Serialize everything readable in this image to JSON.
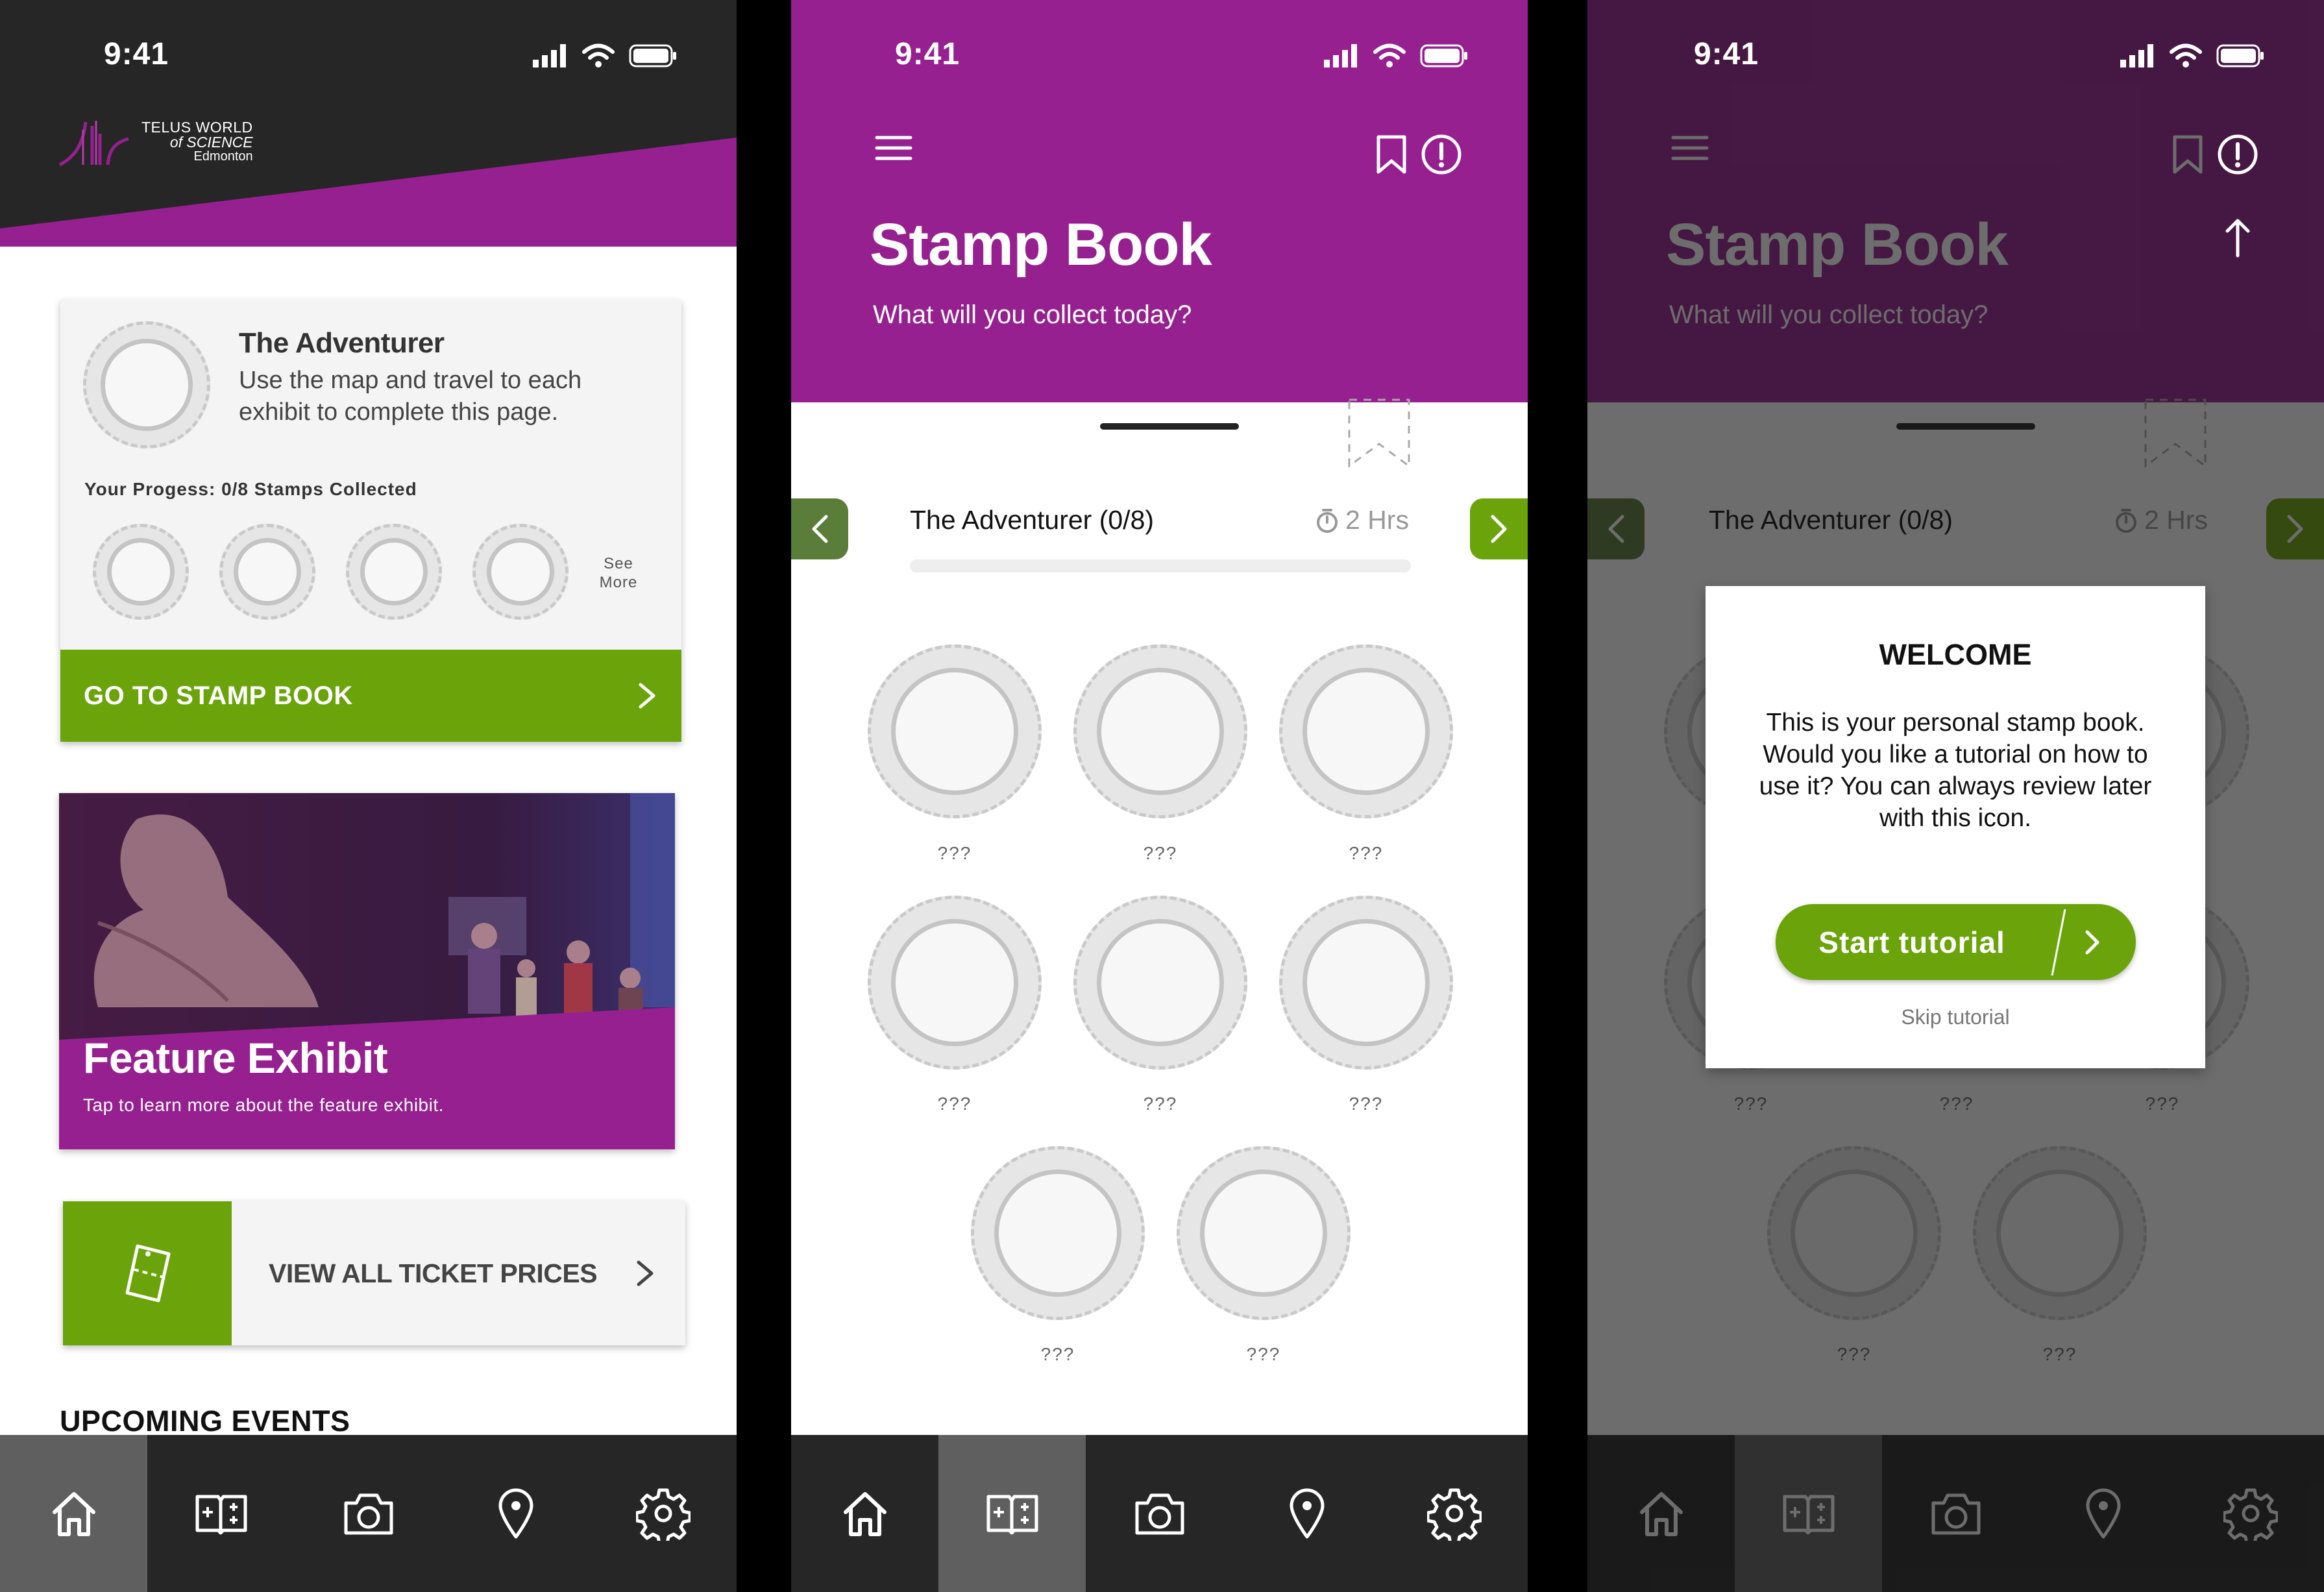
{
  "status": {
    "time": "9:41"
  },
  "screen1": {
    "logo": {
      "line1": "TELUS WORLD",
      "line2": "of SCIENCE",
      "line3": "Edmonton"
    },
    "card": {
      "title": "The Adventurer",
      "desc_line1": "Use the map and travel to each",
      "desc_line2": "exhibit to complete this page.",
      "progress": "Your Progess: 0/8 Stamps Collected",
      "see_more_1": "See",
      "see_more_2": "More",
      "cta": "GO TO STAMP BOOK"
    },
    "feature": {
      "title": "Feature Exhibit",
      "subtitle": "Tap to learn more about the feature exhibit."
    },
    "tickets": {
      "label": "VIEW ALL TICKET PRICES"
    },
    "events_heading": "UPCOMING EVENTS"
  },
  "screen2": {
    "title": "Stamp Book",
    "subtitle": "What will you collect today?",
    "page_title": "The Adventurer (0/8)",
    "duration": "2 Hrs",
    "progress": 0,
    "stamp_labels": [
      "???",
      "???",
      "???",
      "???",
      "???",
      "???",
      "???",
      "???"
    ]
  },
  "screen3": {
    "modal": {
      "heading": "WELCOME",
      "body_l1": "This is your personal stamp book.",
      "body_l2": "Would you like a tutorial on how to",
      "body_l3": "use it? You can always review later",
      "body_l4": "with this icon.",
      "start": "Start tutorial",
      "skip": "Skip tutorial"
    }
  },
  "tabs": [
    "home-icon",
    "stamp-book-icon",
    "camera-icon",
    "map-pin-icon",
    "settings-icon"
  ],
  "colors": {
    "purple": "#962090",
    "green": "#6aa40a",
    "dark": "#262626",
    "tab_active": "#5f5f5f"
  }
}
